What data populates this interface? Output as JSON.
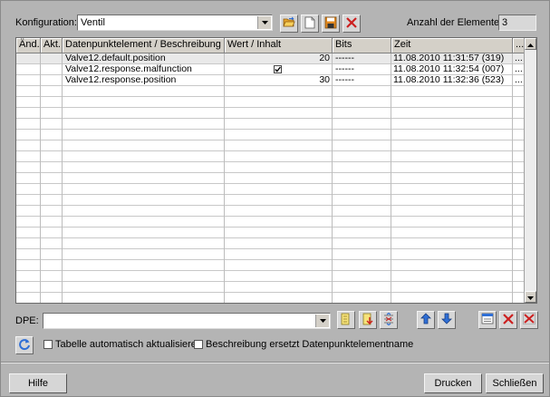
{
  "header": {
    "config_label": "Konfiguration:",
    "config_value": "Ventil",
    "count_label": "Anzahl der Elemente:",
    "count_value": "3"
  },
  "table": {
    "columns": [
      "Änd.",
      "Akt.",
      "Datenpunktelement / Beschreibung",
      "Wert / Inhalt",
      "Bits",
      "Zeit",
      "..."
    ],
    "rows": [
      {
        "name": "Valve12.default.position",
        "value": "20",
        "checked": false,
        "bits": "------",
        "time": "11.08.2010 11:31:57  (319)",
        "more": "..."
      },
      {
        "name": "Valve12.response.malfunction",
        "value": "",
        "checked": true,
        "bits": "------",
        "time": "11.08.2010 11:32:54  (007)",
        "more": "..."
      },
      {
        "name": "Valve12.response.position",
        "value": "30",
        "checked": false,
        "bits": "------",
        "time": "11.08.2010 11:32:36  (523)",
        "more": "..."
      }
    ]
  },
  "dpe": {
    "label": "DPE:",
    "value": ""
  },
  "options": {
    "auto_refresh_label": "Tabelle automatisch aktualisieren",
    "description_replace_label": "Beschreibung ersetzt Datenpunktelementname"
  },
  "footer": {
    "help": "Hilfe",
    "print": "Drucken",
    "close": "Schließen"
  },
  "colors": {
    "dialog_bg": "#b4b4b4",
    "selected_row": "#e9e9e9",
    "blue_arrow": "#2f6fd6",
    "red_x": "#cc1f1f"
  }
}
